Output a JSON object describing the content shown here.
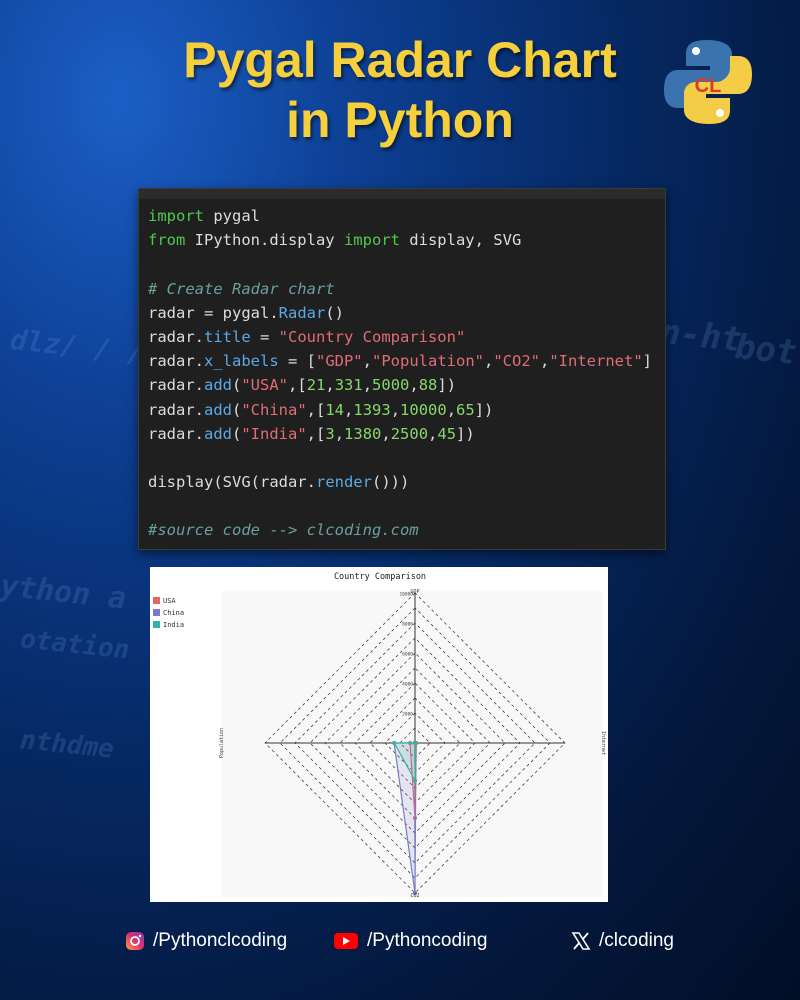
{
  "header": {
    "title_line1": "Pygal Radar Chart",
    "title_line2": "in Python"
  },
  "code_lines": [
    [
      {
        "t": "import",
        "c": "kw"
      },
      {
        "t": " pygal",
        "c": ""
      }
    ],
    [
      {
        "t": "from",
        "c": "kw"
      },
      {
        "t": " IPython.display ",
        "c": ""
      },
      {
        "t": "import",
        "c": "kw"
      },
      {
        "t": " display, SVG",
        "c": ""
      }
    ],
    [],
    [
      {
        "t": "# Create Radar chart",
        "c": "cm"
      }
    ],
    [
      {
        "t": "radar = pygal.",
        "c": ""
      },
      {
        "t": "Radar",
        "c": "fn"
      },
      {
        "t": "()",
        "c": ""
      }
    ],
    [
      {
        "t": "radar.",
        "c": ""
      },
      {
        "t": "title",
        "c": "fn"
      },
      {
        "t": " = ",
        "c": ""
      },
      {
        "t": "\"Country Comparison\"",
        "c": "str"
      }
    ],
    [
      {
        "t": "radar.",
        "c": ""
      },
      {
        "t": "x_labels",
        "c": "fn"
      },
      {
        "t": " = [",
        "c": ""
      },
      {
        "t": "\"GDP\"",
        "c": "str"
      },
      {
        "t": ",",
        "c": ""
      },
      {
        "t": "\"Population\"",
        "c": "str"
      },
      {
        "t": ",",
        "c": ""
      },
      {
        "t": "\"CO2\"",
        "c": "str"
      },
      {
        "t": ",",
        "c": ""
      },
      {
        "t": "\"Internet\"",
        "c": "str"
      },
      {
        "t": "]",
        "c": ""
      }
    ],
    [
      {
        "t": "radar.",
        "c": ""
      },
      {
        "t": "add",
        "c": "fn"
      },
      {
        "t": "(",
        "c": ""
      },
      {
        "t": "\"USA\"",
        "c": "str"
      },
      {
        "t": ",[",
        "c": ""
      },
      {
        "t": "21",
        "c": "num"
      },
      {
        "t": ",",
        "c": ""
      },
      {
        "t": "331",
        "c": "num"
      },
      {
        "t": ",",
        "c": ""
      },
      {
        "t": "5000",
        "c": "num"
      },
      {
        "t": ",",
        "c": ""
      },
      {
        "t": "88",
        "c": "num"
      },
      {
        "t": "])",
        "c": ""
      }
    ],
    [
      {
        "t": "radar.",
        "c": ""
      },
      {
        "t": "add",
        "c": "fn"
      },
      {
        "t": "(",
        "c": ""
      },
      {
        "t": "\"China\"",
        "c": "str"
      },
      {
        "t": ",[",
        "c": ""
      },
      {
        "t": "14",
        "c": "num"
      },
      {
        "t": ",",
        "c": ""
      },
      {
        "t": "1393",
        "c": "num"
      },
      {
        "t": ",",
        "c": ""
      },
      {
        "t": "10000",
        "c": "num"
      },
      {
        "t": ",",
        "c": ""
      },
      {
        "t": "65",
        "c": "num"
      },
      {
        "t": "])",
        "c": ""
      }
    ],
    [
      {
        "t": "radar.",
        "c": ""
      },
      {
        "t": "add",
        "c": "fn"
      },
      {
        "t": "(",
        "c": ""
      },
      {
        "t": "\"India\"",
        "c": "str"
      },
      {
        "t": ",[",
        "c": ""
      },
      {
        "t": "3",
        "c": "num"
      },
      {
        "t": ",",
        "c": ""
      },
      {
        "t": "1380",
        "c": "num"
      },
      {
        "t": ",",
        "c": ""
      },
      {
        "t": "2500",
        "c": "num"
      },
      {
        "t": ",",
        "c": ""
      },
      {
        "t": "45",
        "c": "num"
      },
      {
        "t": "])",
        "c": ""
      }
    ],
    [],
    [
      {
        "t": "display(SVG(radar.",
        "c": ""
      },
      {
        "t": "render",
        "c": "fn"
      },
      {
        "t": "()))",
        "c": ""
      }
    ],
    [],
    [
      {
        "t": "#source code --> clcoding.com",
        "c": "cm"
      }
    ]
  ],
  "chart_data": {
    "type": "radar",
    "title": "Country Comparison",
    "axes": [
      "GDP",
      "Population",
      "CO2",
      "Internet"
    ],
    "rlim": [
      0,
      10000
    ],
    "r_ticks": [
      "2000",
      "4000",
      "6000",
      "8000",
      "10000"
    ],
    "grid": true,
    "legend": "top-left",
    "series": [
      {
        "name": "USA",
        "values": [
          21,
          331,
          5000,
          88
        ],
        "color": "#e06666"
      },
      {
        "name": "China",
        "values": [
          14,
          1393,
          10000,
          65
        ],
        "color": "#7b7bc7"
      },
      {
        "name": "India",
        "values": [
          3,
          1380,
          2500,
          45
        ],
        "color": "#36b3a0"
      }
    ]
  },
  "socials": [
    {
      "icon": "instagram-icon",
      "label": "/Pythonclcoding"
    },
    {
      "icon": "youtube-icon",
      "label": "/Pythoncoding"
    },
    {
      "icon": "x-icon",
      "label": "/clcoding"
    }
  ]
}
